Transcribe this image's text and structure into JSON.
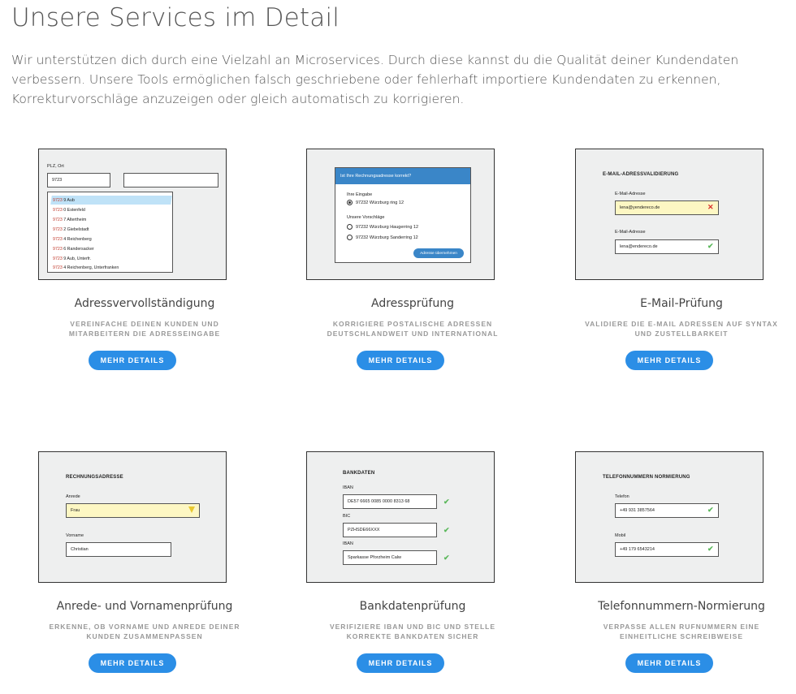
{
  "page": {
    "title": "Unsere Services im Detail",
    "intro": "Wir unterstützen dich durch eine Vielzahl an Microservices. Durch diese kannst du die Qualität deiner Kundendaten verbessern. Unsere Tools ermöglichen falsch geschriebene oder fehlerhaft importiere Kundendaten zu erkennen, Korrekturvorschläge anzuzeigen oder gleich automatisch zu korrigieren."
  },
  "button_label": "MEHR DETAILS",
  "services": [
    {
      "title": "Adressvervollständigung",
      "desc_line1": "VEREINFACHE DEINEN KUNDEN UND",
      "desc_line2": "MITARBEITERN DIE ADRESSEINGABE",
      "sketch": {
        "label": "PLZ, Ort",
        "input_value": "9723",
        "items": [
          {
            "prefix": "9723",
            "rest": " 9 Aub"
          },
          {
            "prefix": "9723",
            "rest": " 0 Estenfeld"
          },
          {
            "prefix": "9723",
            "rest": " 7 Altertheim"
          },
          {
            "prefix": "9723",
            "rest": " 2 Giebelstadt"
          },
          {
            "prefix": "9723",
            "rest": " 4 Reichenberg"
          },
          {
            "prefix": "9723",
            "rest": " 6 Randersacker"
          },
          {
            "prefix": "9723",
            "rest": " 9 Aub, Unterfr."
          },
          {
            "prefix": "9723",
            "rest": " 4 Reichenberg, Unterfranken"
          }
        ]
      }
    },
    {
      "title": "Adressprüfung",
      "desc_line1": "KORRIGIERE POSTALISCHE ADRESSEN",
      "desc_line2": "DEUTSCHLANDWEIT UND INTERNATIONAL",
      "sketch": {
        "dialog_title": "Ist Ihre Rechnungsadresse korrekt?",
        "input_heading": "Ihre Eingabe",
        "input_option": "97232 Würzburg ring 12",
        "suggest_heading": "Unsere Vorschläge",
        "suggest_1": "97232 Würzburg Haugerring 12",
        "suggest_2": "97232 Würzburg Sanderring 12",
        "apply_button": "Adresse übernehmen"
      }
    },
    {
      "title": "E-Mail-Prüfung",
      "desc_line1": "VALIDIERE DIE E-MAIL ADRESSEN AUF SYNTAX",
      "desc_line2": "UND ZUSTELLBARKEIT",
      "sketch": {
        "heading": "E-MAIL-ADRESSVALIDIERUNG",
        "label_1": "E-Mail-Adresse",
        "value_1": "lena@yendereco.de",
        "label_2": "E-Mail-Adresse",
        "value_2": "lena@endereco.de"
      }
    },
    {
      "title": "Anrede- und Vornamenprüfung",
      "desc_line1": "ERKENNE, OB VORNAME UND ANREDE DEINER",
      "desc_line2": "KUNDEN ZUSAMMENPASSEN",
      "sketch": {
        "heading": "RECHNUNGSADRESSE",
        "label_1": "Anrede",
        "value_1": "Frau",
        "label_2": "Vorname",
        "value_2": "Christian"
      }
    },
    {
      "title": "Bankdatenprüfung",
      "desc_line1": "VERIFIZIERE IBAN UND BIC UND STELLE",
      "desc_line2": "KORREKTE BANKDATEN SICHER",
      "sketch": {
        "heading": "BANKDATEN",
        "label_1": "IBAN",
        "value_1": "DE57 6665 0085 0000 8313 68",
        "label_2": "BIC",
        "value_2": "PZHSDE66XXX",
        "label_3": "IBAN",
        "value_3": "Sparkasse Pforzheim Calw"
      }
    },
    {
      "title": "Telefonnummern-Normierung",
      "desc_line1": "VERPASSE ALLEN RUFNUMMERN EINE",
      "desc_line2": "EINHEITLICHE SCHREIBWEISE",
      "sketch": {
        "heading": "TELEFONNUMMERN NORMIERUNG",
        "label_1": "Telefon",
        "value_1": "+49 931 3857564",
        "label_2": "Mobil",
        "value_2": "+49 179 6543214"
      }
    }
  ]
}
